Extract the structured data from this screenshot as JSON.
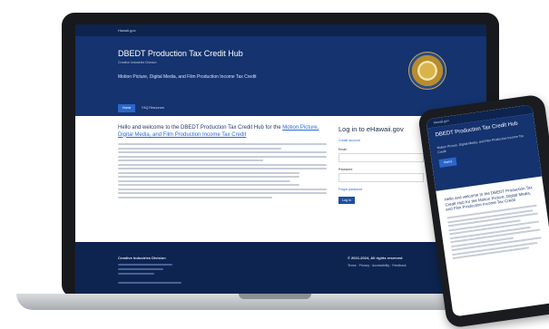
{
  "site": {
    "top_label": "Hawaii.gov",
    "title": "DBEDT Production Tax Credit Hub",
    "subtitle": "Creative Industries Division",
    "description": "Motion Picture, Digital Media, and Film Production Income Tax Credit",
    "nav": [
      {
        "label": "Home"
      },
      {
        "label": "FAQ Resources"
      }
    ]
  },
  "main": {
    "welcome_prefix": "Hello and welcome to the DBEDT Production Tax Credit Hub for the",
    "welcome_link": "Motion Picture, Digital Media, and Film Production Income Tax Credit",
    "paragraph_lines": [
      8,
      4,
      8,
      8,
      4,
      8,
      8,
      6,
      6,
      6,
      6,
      8,
      8,
      6
    ]
  },
  "login": {
    "title": "Log in to eHawaii.gov",
    "create_account": "Create account",
    "email_label": "Email",
    "password_label": "Password",
    "forgot": "Forgot password",
    "button": "Log In"
  },
  "footer": {
    "org": "Creative Industries Division",
    "copyright": "© 2021-2024, All rights reserved",
    "links": "Terms · Privacy · Accessibility · Feedback"
  },
  "phone": {
    "top_label": "Hawaii.gov",
    "title": "DBEDT Production Tax Credit Hub",
    "description": "Motion Picture, Digital Media, and Film Production Income Tax Credit",
    "welcome": "Hello and welcome to the DBEDT Production Tax Credit Hub for the Motion Picture, Digital Media, and Film Production Income Tax Credit"
  },
  "colors": {
    "navy": "#14336f",
    "dark_navy": "#0e2450",
    "accent": "#2b66c9"
  }
}
